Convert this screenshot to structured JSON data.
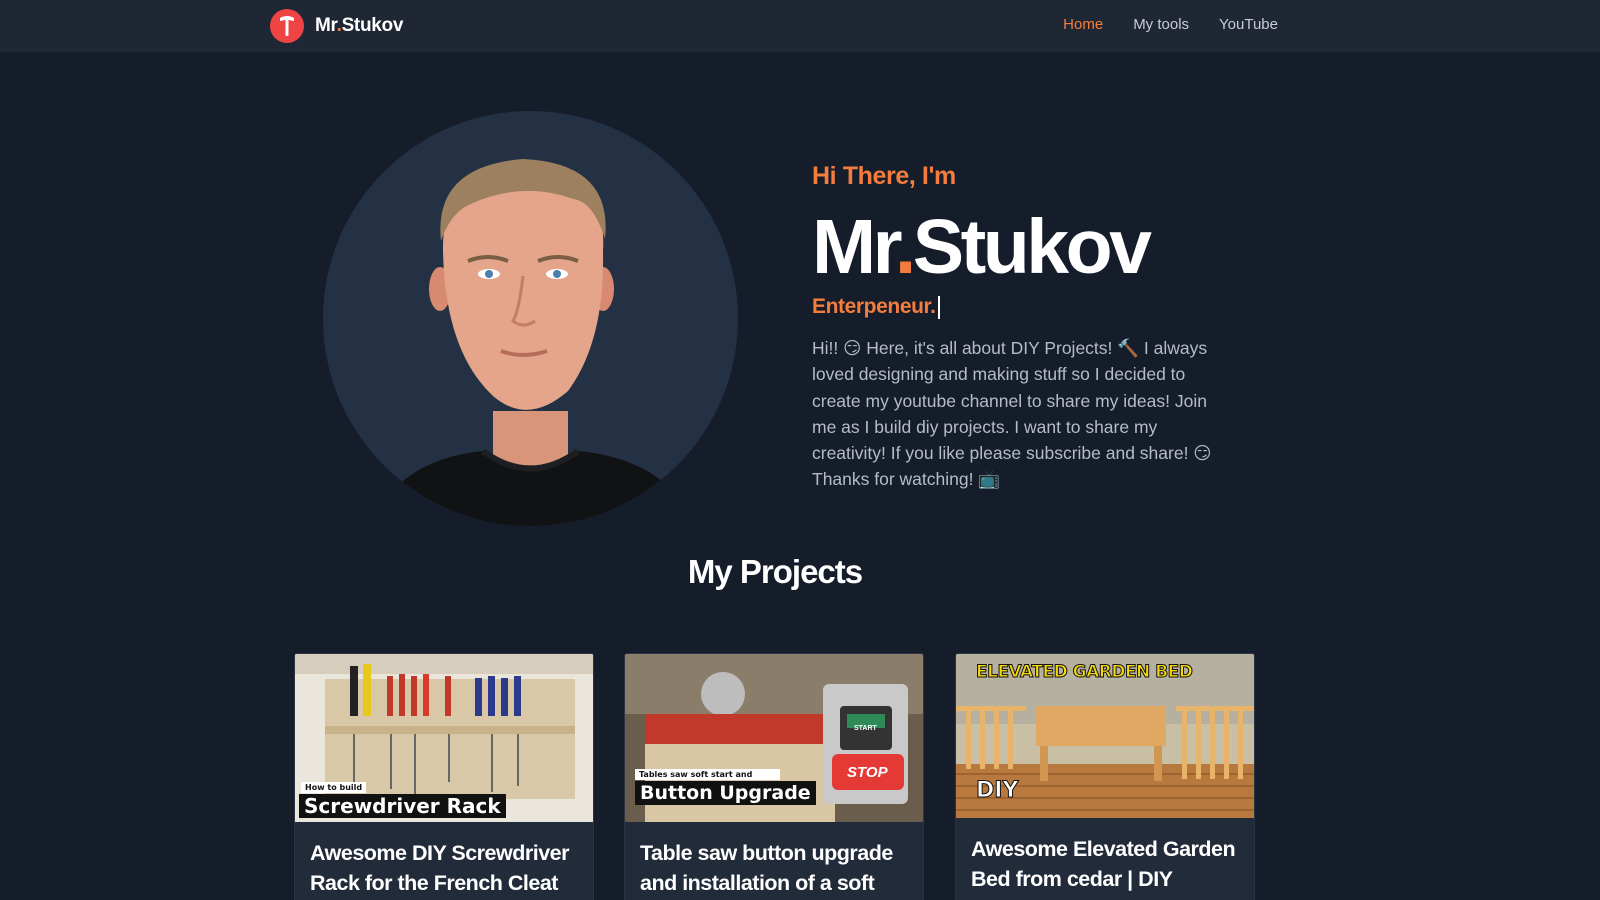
{
  "nav": {
    "brand_first": "Mr",
    "brand_dot": ".",
    "brand_last": "Stukov",
    "links": [
      "Home",
      "My tools",
      "YouTube"
    ],
    "active": "Home"
  },
  "hero": {
    "greeting": "Hi There, I'm",
    "name_first": "Mr",
    "name_dot": ".",
    "name_last": "Stukov",
    "role": "Enterpeneur.",
    "bio_lines": [
      "Hi!! 😏 Here, it's all about DIY Projects! 🔨 I always",
      "loved designing and making stuff so I decided to",
      "create my youtube channel to share my ideas! Join",
      "me as I build diy projects. I want to share my",
      "creativity! If you like please subscribe and share! 😏",
      "Thanks for watching! 📺"
    ]
  },
  "projects": {
    "title": "My Projects",
    "cards": [
      {
        "thumb_small": "How to build",
        "thumb_caption": "Screwdriver Rack",
        "title_lines": [
          "Awesome DIY Screwdriver",
          "Rack for the French Cleat"
        ]
      },
      {
        "thumb_small": "Tables saw soft start and",
        "thumb_caption": "Button Upgrade",
        "thumb_stop": "STOP",
        "thumb_start": "START",
        "title_lines": [
          "Table saw button upgrade",
          "and installation of a soft"
        ]
      },
      {
        "thumb_banner": "ELEVATED GARDEN BED",
        "thumb_caption": "DIY",
        "title_lines": [
          "Awesome Elevated Garden",
          "Bed from cedar | DIY"
        ]
      }
    ]
  },
  "colors": {
    "background": "#151d2b",
    "navbar": "#1f2734",
    "accent": "#f47c3c",
    "logo": "#ef4444",
    "card": "#222b3a"
  },
  "icons": [
    "hammer-logo-icon"
  ]
}
